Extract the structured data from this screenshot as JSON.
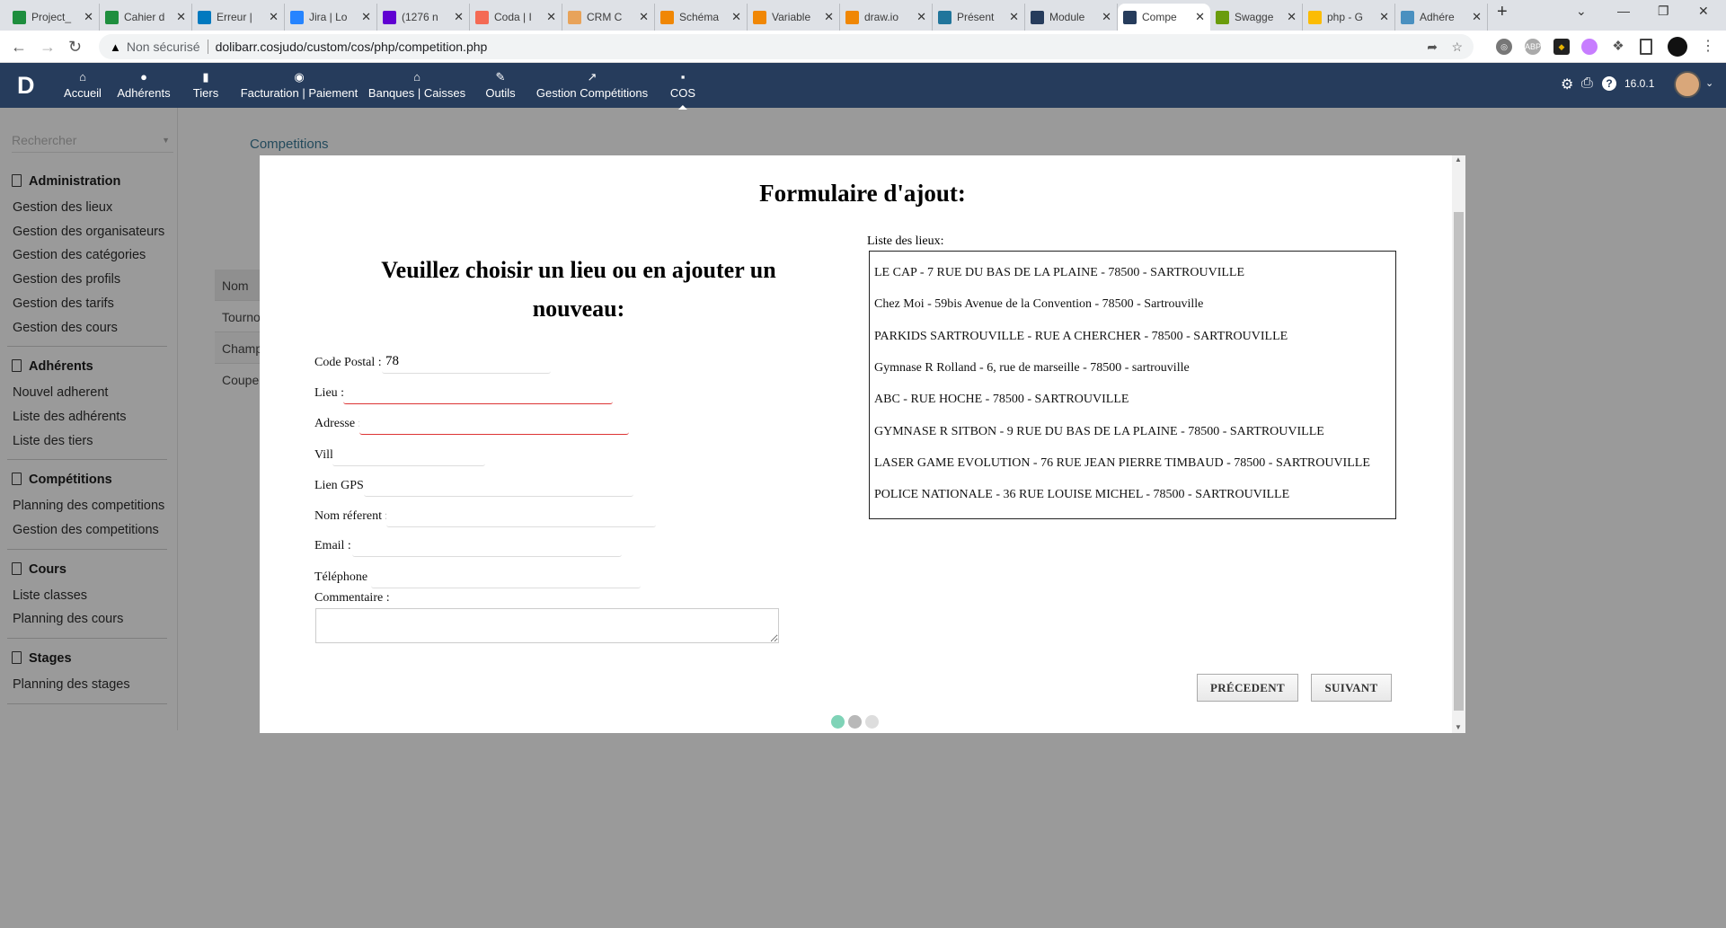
{
  "browser": {
    "tabs": [
      {
        "label": "Project_",
        "icon": "google-sheets-icon",
        "color": "#1e8e3e"
      },
      {
        "label": "Cahier d",
        "icon": "google-sheets-icon",
        "color": "#1e8e3e"
      },
      {
        "label": "Erreur |",
        "icon": "trello-icon",
        "color": "#0079bf"
      },
      {
        "label": "Jira | Lo",
        "icon": "jira-icon",
        "color": "#2684ff"
      },
      {
        "label": "(1276 n",
        "icon": "mail-icon",
        "color": "#6001d2"
      },
      {
        "label": "Coda | I",
        "icon": "coda-icon",
        "color": "#f46a54"
      },
      {
        "label": "CRM C",
        "icon": "crm-icon",
        "color": "#e8a35a"
      },
      {
        "label": "Schéma",
        "icon": "drawio-icon",
        "color": "#f08705"
      },
      {
        "label": "Variable",
        "icon": "drawio-icon",
        "color": "#f08705"
      },
      {
        "label": "draw.io",
        "icon": "drawio-icon",
        "color": "#f08705"
      },
      {
        "label": "Présent",
        "icon": "wordpress-icon",
        "color": "#21759b"
      },
      {
        "label": "Module",
        "icon": "dolibarr-icon",
        "color": "#263c5c"
      },
      {
        "label": "Compe",
        "icon": "dolibarr-icon",
        "color": "#263c5c",
        "active": true
      },
      {
        "label": "Swagge",
        "icon": "swagger-icon",
        "color": "#6a9c0c"
      },
      {
        "label": "php - G",
        "icon": "google-drive-icon",
        "color": "#fbbc04"
      },
      {
        "label": "Adhére",
        "icon": "chart-icon",
        "color": "#4a90c0"
      }
    ],
    "security": "Non sécurisé",
    "url": "dolibarr.cosjudo/custom/cos/php/competition.php"
  },
  "topnav": {
    "logo": "D",
    "items": [
      {
        "label": "Accueil",
        "icon": "home-icon"
      },
      {
        "label": "Adhérents",
        "icon": "user-icon"
      },
      {
        "label": "Tiers",
        "icon": "building-icon"
      },
      {
        "label": "Facturation | Paiement",
        "icon": "coins-icon"
      },
      {
        "label": "Banques | Caisses",
        "icon": "bank-icon"
      },
      {
        "label": "Outils",
        "icon": "wrench-icon"
      },
      {
        "label": "Gestion Compétitions",
        "icon": "external-link-icon"
      },
      {
        "label": "COS",
        "icon": "file-icon",
        "active": true
      }
    ],
    "version": "16.0.1"
  },
  "sidebar": {
    "search_placeholder": "Rechercher",
    "sections": [
      {
        "title": "Administration",
        "items": [
          "Gestion des lieux",
          "Gestion des organisateurs",
          "Gestion des catégories",
          "Gestion des profils",
          "Gestion des tarifs",
          "Gestion des cours"
        ]
      },
      {
        "title": "Adhérents",
        "items": [
          "Nouvel adherent",
          "Liste des adhérents",
          "Liste des tiers"
        ]
      },
      {
        "title": "Compétitions",
        "items": [
          "Planning des competitions",
          "Gestion des competitions"
        ]
      },
      {
        "title": "Cours",
        "items": [
          "Liste classes",
          "Planning des cours"
        ]
      },
      {
        "title": "Stages",
        "items": [
          "Planning des stages"
        ]
      }
    ]
  },
  "page": {
    "title": "Competitions",
    "table": {
      "header": "Nom",
      "rows": [
        "Tourno",
        "Champ",
        "Coupe"
      ]
    }
  },
  "modal": {
    "title": "Formulaire d'ajout:",
    "subtitle_line1": "Veuillez choisir un lieu ou en ajouter un",
    "subtitle_line2": "nouveau:",
    "fields": [
      {
        "label": "Code Postal :",
        "value": "78"
      },
      {
        "label": "Lieu :",
        "value": ""
      },
      {
        "label": "Adresse :",
        "value": ""
      },
      {
        "label": "Ville :",
        "value": ""
      },
      {
        "label": "Lien GPS :",
        "value": ""
      },
      {
        "label": "Nom réferent :",
        "value": ""
      },
      {
        "label": "Email :",
        "value": ""
      },
      {
        "label": "Téléphone :",
        "value": ""
      }
    ],
    "comment_label": "Commentaire :",
    "list_label": "Liste des lieux:",
    "lieux": [
      "LE CAP - 7 RUE DU BAS DE LA PLAINE - 78500 - SARTROUVILLE",
      "Chez Moi - 59bis Avenue de la Convention - 78500 - Sartrouville",
      "PARKIDS SARTROUVILLE - RUE A CHERCHER - 78500 - SARTROUVILLE",
      "Gymnase R Rolland - 6, rue de marseille - 78500 - sartrouville",
      "ABC - RUE HOCHE - 78500 - SARTROUVILLE",
      "GYMNASE R SITBON - 9 RUE DU BAS DE LA PLAINE - 78500 - SARTROUVILLE",
      "LASER GAME EVOLUTION - 76 RUE JEAN PIERRE TIMBAUD - 78500 - SARTROUVILLE",
      "POLICE NATIONALE - 36 RUE LOUISE MICHEL - 78500 - SARTROUVILLE"
    ],
    "prev_label": "PRÉCEDENT",
    "next_label": "SUIVANT",
    "step_current": 1,
    "step_total": 3,
    "step_colors": [
      "#7fd3b7",
      "#b8b8b8",
      "#dddddd"
    ]
  }
}
